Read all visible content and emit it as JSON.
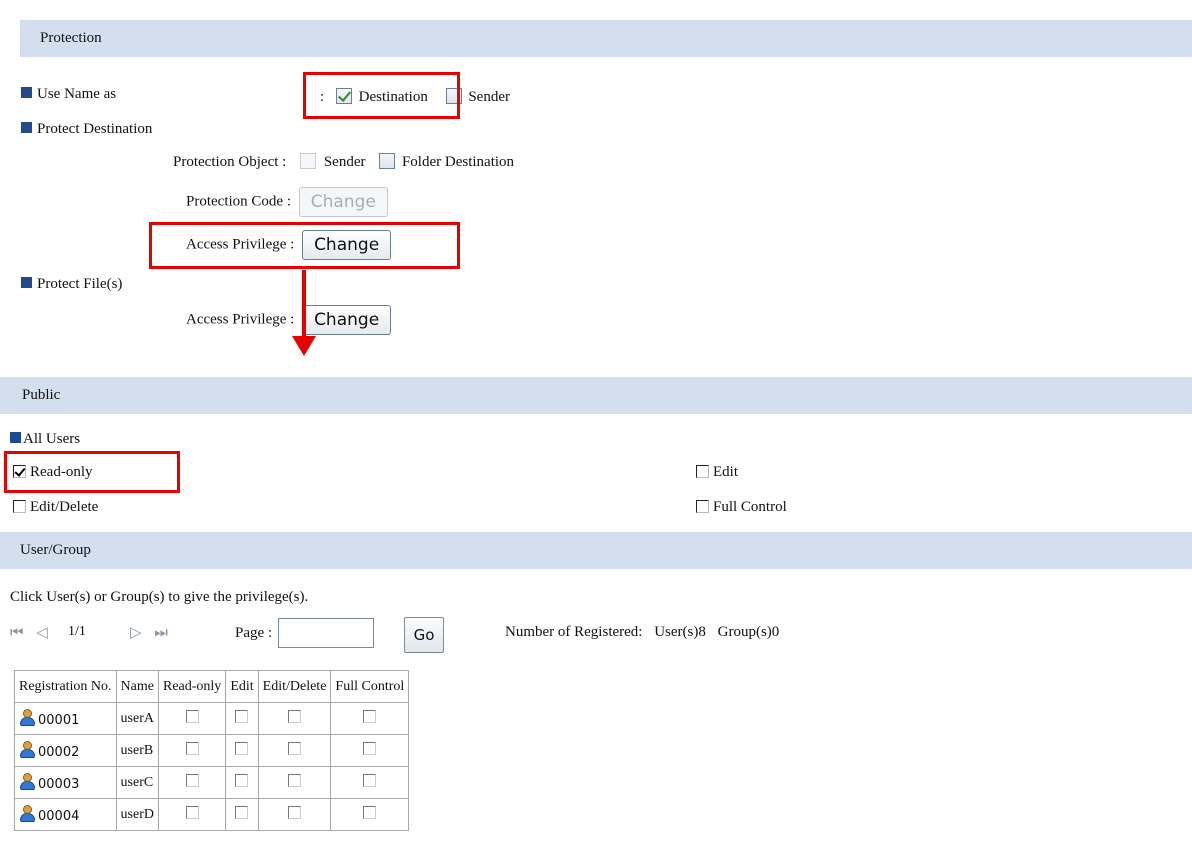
{
  "protection": {
    "header": "Protection",
    "use_name_as": {
      "label": "Use Name as",
      "colon": ":",
      "destination_label": "Destination",
      "destination_checked": true,
      "sender_label": "Sender",
      "sender_checked": false
    },
    "protect_destination": {
      "label": "Protect Destination",
      "protection_object_label": "Protection Object :",
      "sender_label": "Sender",
      "folder_destination_label": "Folder Destination",
      "protection_code_label": "Protection Code :",
      "protection_code_button": "Change",
      "access_privilege_label": "Access Privilege :",
      "access_privilege_button": "Change"
    },
    "protect_files": {
      "label": "Protect File(s)",
      "access_privilege_label": "Access Privilege :",
      "access_privilege_button": "Change"
    }
  },
  "public": {
    "header": "Public",
    "all_users_label": "All Users",
    "options": {
      "read_only": {
        "label": "Read-only",
        "checked": true
      },
      "edit": {
        "label": "Edit",
        "checked": false
      },
      "edit_delete": {
        "label": "Edit/Delete",
        "checked": false
      },
      "full_control": {
        "label": "Full Control",
        "checked": false
      }
    }
  },
  "user_group": {
    "header": "User/Group",
    "instruction": "Click User(s) or Group(s) to give the privilege(s).",
    "pager": {
      "first_icon": "first-page-icon",
      "prev_icon": "prev-page-icon",
      "current": "1/1",
      "next_icon": "next-page-icon",
      "last_icon": "last-page-icon",
      "page_label": "Page :",
      "page_value": "",
      "go_label": "Go"
    },
    "registered": {
      "label": "Number of Registered:",
      "users": "User(s)8",
      "groups": "Group(s)0"
    },
    "table": {
      "headers": [
        "Registration No.",
        "Name",
        "Read-only",
        "Edit",
        "Edit/Delete",
        "Full Control"
      ],
      "rows": [
        {
          "reg_no": "00001",
          "name": "userA"
        },
        {
          "reg_no": "00002",
          "name": "userB"
        },
        {
          "reg_no": "00003",
          "name": "userC"
        },
        {
          "reg_no": "00004",
          "name": "userD"
        }
      ]
    }
  },
  "colors": {
    "header_bg": "#d3dfef",
    "bullet": "#1f4a8f",
    "highlight": "#e60000"
  }
}
